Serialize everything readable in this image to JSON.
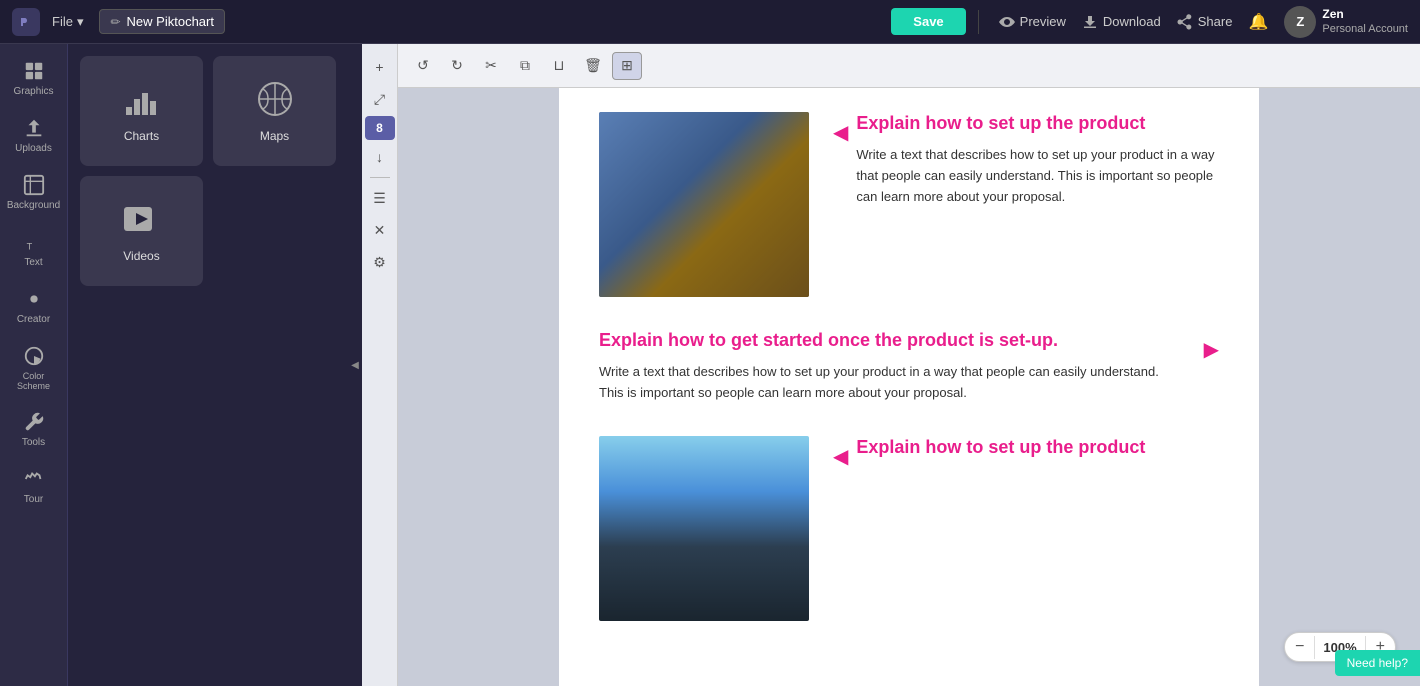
{
  "topnav": {
    "logo_text": "P",
    "file_label": "File",
    "file_chevron": "▾",
    "title": "New Piktochart",
    "title_icon": "✏",
    "save_label": "Save",
    "preview_label": "Preview",
    "download_label": "Download",
    "share_label": "Share",
    "user_name": "Zen",
    "user_sub": "Personal Account"
  },
  "sidebar": {
    "items": [
      {
        "id": "graphics",
        "label": "Graphics",
        "icon": "graphics"
      },
      {
        "id": "uploads",
        "label": "Uploads",
        "icon": "uploads"
      },
      {
        "id": "background",
        "label": "Background",
        "icon": "background"
      },
      {
        "id": "text",
        "label": "Text",
        "icon": "text"
      },
      {
        "id": "creator",
        "label": "Creator",
        "icon": "creator"
      },
      {
        "id": "color-scheme",
        "label": "Color Scheme",
        "icon": "color"
      },
      {
        "id": "tools",
        "label": "Tools",
        "icon": "tools"
      },
      {
        "id": "tour",
        "label": "Tour",
        "icon": "tour"
      }
    ]
  },
  "panel": {
    "items": [
      {
        "id": "charts",
        "label": "Charts",
        "icon": "charts"
      },
      {
        "id": "maps",
        "label": "Maps",
        "icon": "maps"
      },
      {
        "id": "videos",
        "label": "Videos",
        "icon": "videos"
      }
    ]
  },
  "toolbar_horiz": {
    "buttons": [
      {
        "id": "undo",
        "icon": "↺",
        "label": "Undo"
      },
      {
        "id": "redo",
        "icon": "↻",
        "label": "Redo"
      },
      {
        "id": "cut",
        "icon": "✂",
        "label": "Cut"
      },
      {
        "id": "copy",
        "icon": "⧉",
        "label": "Copy"
      },
      {
        "id": "paste",
        "icon": "📋",
        "label": "Paste"
      },
      {
        "id": "delete",
        "icon": "🗑",
        "label": "Delete"
      },
      {
        "id": "grid",
        "icon": "⊞",
        "label": "Grid",
        "active": true
      }
    ]
  },
  "toolbar_vert": {
    "add_label": "+",
    "badge_value": "8",
    "buttons": [
      {
        "id": "add",
        "icon": "+"
      },
      {
        "id": "expand",
        "icon": "⤢"
      },
      {
        "id": "move-down",
        "icon": "↓"
      },
      {
        "id": "list",
        "icon": "☰"
      },
      {
        "id": "close",
        "icon": "✕"
      },
      {
        "id": "settings",
        "icon": "⚙"
      }
    ]
  },
  "canvas": {
    "blocks": [
      {
        "id": "block1",
        "layout": "right-text",
        "heading": "Explain how to set up the product",
        "body": "Write a text that describes how to set up your product in a way that people can easily understand. This is important so people can learn more about  your proposal.",
        "has_image": true,
        "image_type": "laptop",
        "arrow_dir": "left"
      },
      {
        "id": "block2",
        "layout": "left-text",
        "heading": "Explain how to get started once the product is set-up.",
        "body": "Write a text that describes how to set up your product in a way that people can easily understand. This is important so people can learn more about  your proposal.",
        "has_image": false,
        "arrow_dir": "right"
      },
      {
        "id": "block3",
        "layout": "right-text",
        "heading": "Explain how to set up the product",
        "body": "",
        "has_image": true,
        "image_type": "building",
        "arrow_dir": "left"
      }
    ]
  },
  "zoom": {
    "value": "100%",
    "minus": "−",
    "plus": "+"
  },
  "need_help_label": "Need help?"
}
